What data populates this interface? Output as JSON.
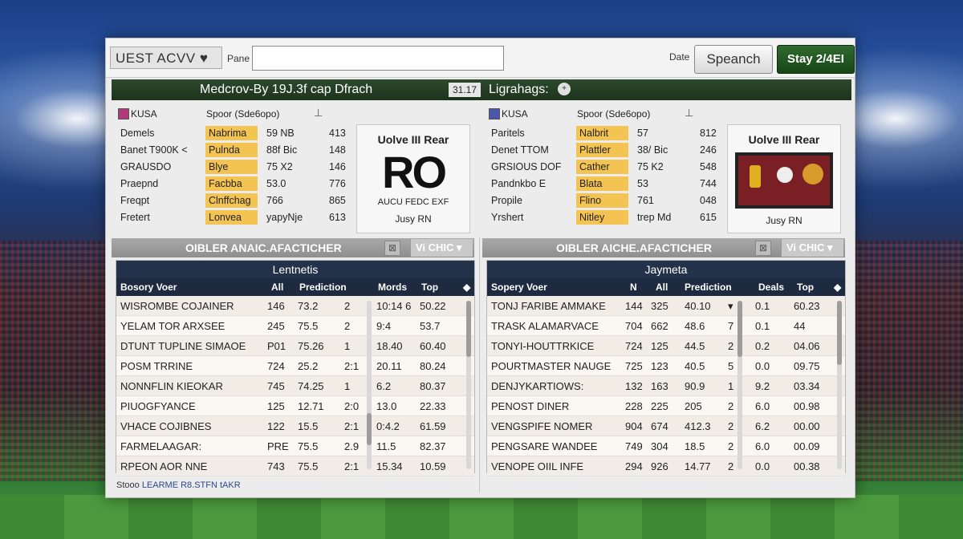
{
  "app": {
    "logo": "UEST ACVV ♥",
    "pane_label": "Pane",
    "search_value": "",
    "date_label": "Date",
    "search_button": "Speanch",
    "stay_button": "Stay 2/4EI"
  },
  "match": {
    "title": "Medcrov-By 19J.3f cap Dfrach",
    "code": "31.17",
    "league": "Ligrahags:",
    "league_icon": "plus-circle-icon"
  },
  "teams": [
    {
      "code": "KUSA",
      "flag_color": "#b03a7a",
      "sport": "Spoor (Sde6opo)",
      "pin": "⊥",
      "stats": [
        [
          "Demels",
          "Nabrima",
          "59 NB",
          "413"
        ],
        [
          "Banet T900K <",
          "Pulnda",
          "88f Bic",
          "148"
        ],
        [
          "GRAUSDO",
          "Blye",
          "75 X2",
          "146"
        ],
        [
          "Praepnd",
          "Facbba",
          "53.0",
          "776"
        ],
        [
          "Freqpt",
          "Clnffchag",
          "766",
          "865"
        ],
        [
          "Fretert",
          "Lonvea",
          "yapyNje",
          "613"
        ]
      ],
      "vs": {
        "title": "Uolve III Rear",
        "score": "RO",
        "sub": "AUCU FEDC EXF",
        "foot": "Jusy RN"
      }
    },
    {
      "code": "KUSA",
      "flag_color": "#4a5aa8",
      "sport": "Spoor (Sde6opo)",
      "pin": "⊥",
      "stats": [
        [
          "Paritels",
          "Nalbrit",
          "57",
          "812"
        ],
        [
          "Denet TTOM",
          "Plattler",
          "38/ Bic",
          "246"
        ],
        [
          "GRSIOUS DOF",
          "Cather",
          "75 K2",
          "548"
        ],
        [
          "Pandnkbo E",
          "Blata",
          "53",
          "744"
        ],
        [
          "Propile",
          "Flino",
          "761",
          "048"
        ],
        [
          "Yrshert",
          "Nitley",
          "trep Md",
          "615"
        ]
      ],
      "vs": {
        "title": "Uolve III Rear",
        "foot": "Jusy RN"
      }
    }
  ],
  "sections": [
    {
      "title": "OIBLER ANAIC.AFACTICHER",
      "icon": "collapse-icon",
      "dropdown": "Vi CHIC ▾"
    },
    {
      "title": "OIBLER AICHE.AFACTICHER",
      "icon": "collapse-icon",
      "dropdown": "Vi CHIC ▾"
    }
  ],
  "tables": [
    {
      "caption": "Lentnetis",
      "headers": [
        "Bosory Voer",
        "All",
        "Prediction",
        "Mords",
        "Top",
        "◆"
      ],
      "rows": [
        [
          "WISROMBE COJAINER",
          "146",
          "73.2",
          "2",
          "10:14 6",
          "50.22"
        ],
        [
          "YELAM TOR ARXSEE",
          "245",
          "75.5",
          "2",
          "9:4",
          "53.7"
        ],
        [
          "DTUNT TUPLINE SIMAOE",
          "P01",
          "75.26",
          "1",
          "18.40",
          "60.40"
        ],
        [
          "POSM TRRINE",
          "724",
          "25.2",
          "2:1",
          "20.11",
          "80.24"
        ],
        [
          "NONNFLIN KIEOKAR",
          "745",
          "74.25",
          "1",
          "6.2",
          "80.37"
        ],
        [
          "PIUOGFYANCE",
          "125",
          "12.71",
          "2:0",
          "13.0",
          "22.33"
        ],
        [
          "VHACE COJIBNES",
          "122",
          "15.5",
          "2:1",
          "0:4.2",
          "61.59"
        ],
        [
          "FARMELAAGAR:",
          "PRE",
          "75.5",
          "2.9",
          "11.5",
          "82.37"
        ],
        [
          "RPEON AOR NNE",
          "743",
          "75.5",
          "2:1",
          "15.34",
          "10.59"
        ]
      ]
    },
    {
      "caption": "Jaymeta",
      "headers": [
        "Sopery Voer",
        "N",
        "All",
        "Prediction",
        "Deals",
        "Top",
        "◆"
      ],
      "rows": [
        [
          "TONJ FARIBE AMMAKE",
          "144",
          "325",
          "40.10",
          "▾",
          "0.1",
          "60.23"
        ],
        [
          "TRASK ALAMARVACE",
          "704",
          "662",
          "48.6",
          "7",
          "0.1",
          "44"
        ],
        [
          "TONYI-HOUTTRKICE",
          "724",
          "125",
          "44.5",
          "2",
          "0.2",
          "04.06"
        ],
        [
          "POURTMASTER NAUGE",
          "725",
          "123",
          "40.5",
          "5",
          "0.0",
          "09.75"
        ],
        [
          "DENJYKARTIOWS:",
          "132",
          "163",
          "90.9",
          "1",
          "9.2",
          "03.34"
        ],
        [
          "PENOST DINER",
          "228",
          "225",
          "205",
          "2",
          "6.0",
          "00.98"
        ],
        [
          "VENGSPIFE NOMER",
          "904",
          "674",
          "412.3",
          "2",
          "6.2",
          "00.00"
        ],
        [
          "PENGSARE WANDEE",
          "749",
          "304",
          "18.5",
          "2",
          "6.0",
          "00.09"
        ],
        [
          "VENOPE OIIL INFE",
          "294",
          "926",
          "14.77",
          "2",
          "0.0",
          "00.38"
        ]
      ]
    }
  ],
  "footer": {
    "label": "Stooo",
    "link": "LEARME R8.STFN tAKR"
  }
}
